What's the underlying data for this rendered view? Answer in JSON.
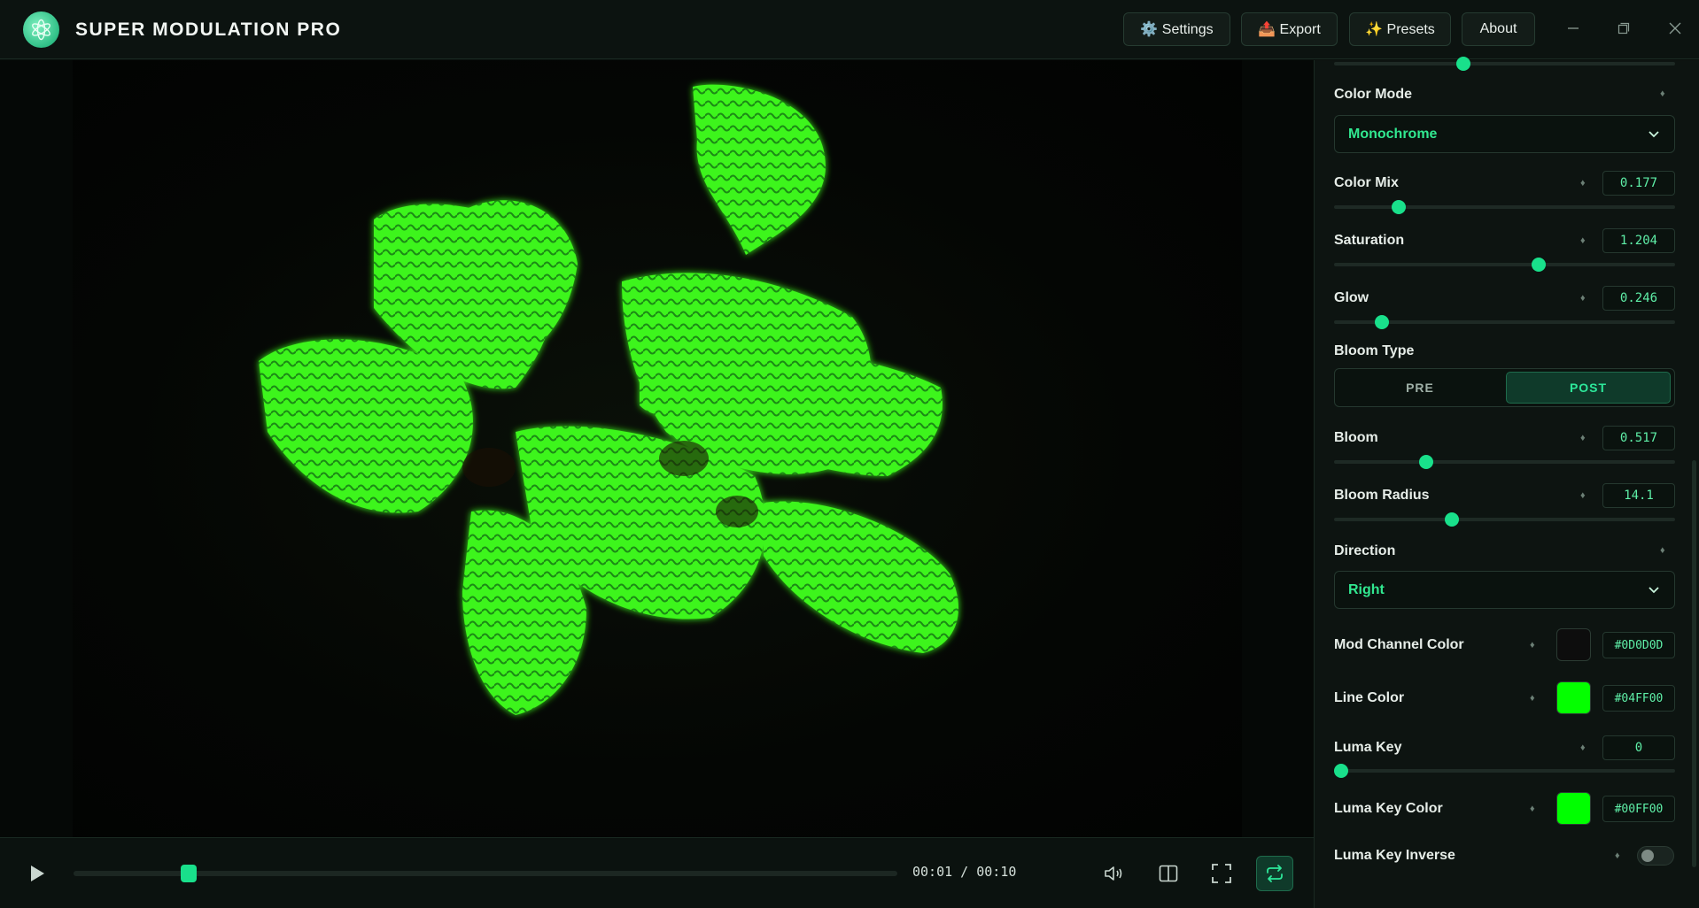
{
  "app": {
    "title": "SUPER MODULATION PRO"
  },
  "toolbar": {
    "settings": "⚙️ Settings",
    "export": "📤 Export",
    "presets": "✨ Presets",
    "about": "About"
  },
  "player": {
    "time": "00:01 / 00:10",
    "progress": 0.13,
    "loop_active": true
  },
  "panel": {
    "top_slider": {
      "value_fraction": 0.38
    },
    "color_mode": {
      "label": "Color Mode",
      "value": "Monochrome"
    },
    "color_mix": {
      "label": "Color Mix",
      "value": "0.177",
      "fraction": 0.19
    },
    "saturation": {
      "label": "Saturation",
      "value": "1.204",
      "fraction": 0.6
    },
    "glow": {
      "label": "Glow",
      "value": "0.246",
      "fraction": 0.14
    },
    "bloom_type": {
      "label": "Bloom Type",
      "options": [
        "PRE",
        "POST"
      ],
      "selected": "POST"
    },
    "bloom": {
      "label": "Bloom",
      "value": "0.517",
      "fraction": 0.27
    },
    "bloom_radius": {
      "label": "Bloom Radius",
      "value": "14.1",
      "fraction": 0.345
    },
    "direction": {
      "label": "Direction",
      "value": "Right"
    },
    "mod_channel_color": {
      "label": "Mod Channel Color",
      "hex": "#0D0D0D"
    },
    "line_color": {
      "label": "Line Color",
      "hex": "#04FF00"
    },
    "luma_key": {
      "label": "Luma Key",
      "value": "0",
      "fraction": 0.0
    },
    "luma_key_color": {
      "label": "Luma Key Color",
      "hex": "#00FF00"
    },
    "luma_key_inverse": {
      "label": "Luma Key Inverse",
      "on": false
    }
  },
  "colors": {
    "accent": "#19E08B",
    "line": "#04FF00"
  }
}
